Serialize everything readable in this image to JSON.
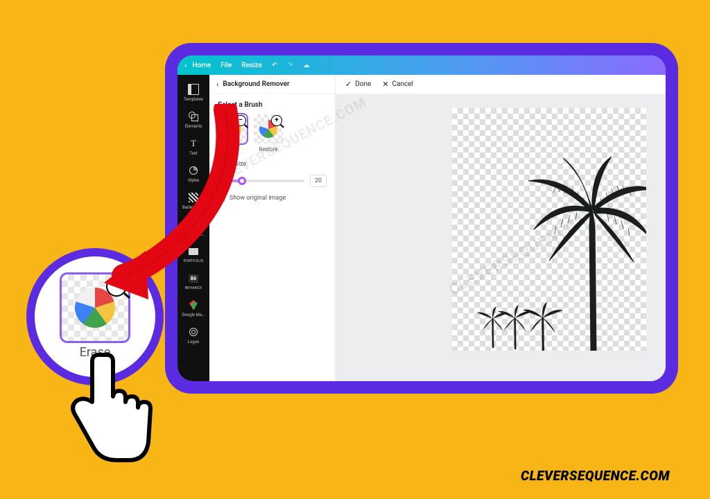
{
  "topbar": {
    "home": "Home",
    "file": "File",
    "resize": "Resize"
  },
  "rail": {
    "templates": "Templates",
    "elements": "Elements",
    "text": "Text",
    "styles": "Styles",
    "background": "Background",
    "all_your_de": "All your de...",
    "portfolio": "PORTFOLIO",
    "behance": "BEHANCE",
    "google_ma": "Google Ma...",
    "logos": "Logos"
  },
  "panel": {
    "title": "Background Remover",
    "select_brush": "Select a Brush",
    "erase": "Erase",
    "restore": "Restore",
    "brush_size_label": "Brush size",
    "brush_size_value": "20",
    "show_original": "Show original image"
  },
  "actions": {
    "done": "Done",
    "cancel": "Cancel"
  },
  "callout": {
    "label": "Erase"
  },
  "watermark": "CLEVERSEQUENCE.COM",
  "credit": "CLEVERSEQUENCE.COM"
}
